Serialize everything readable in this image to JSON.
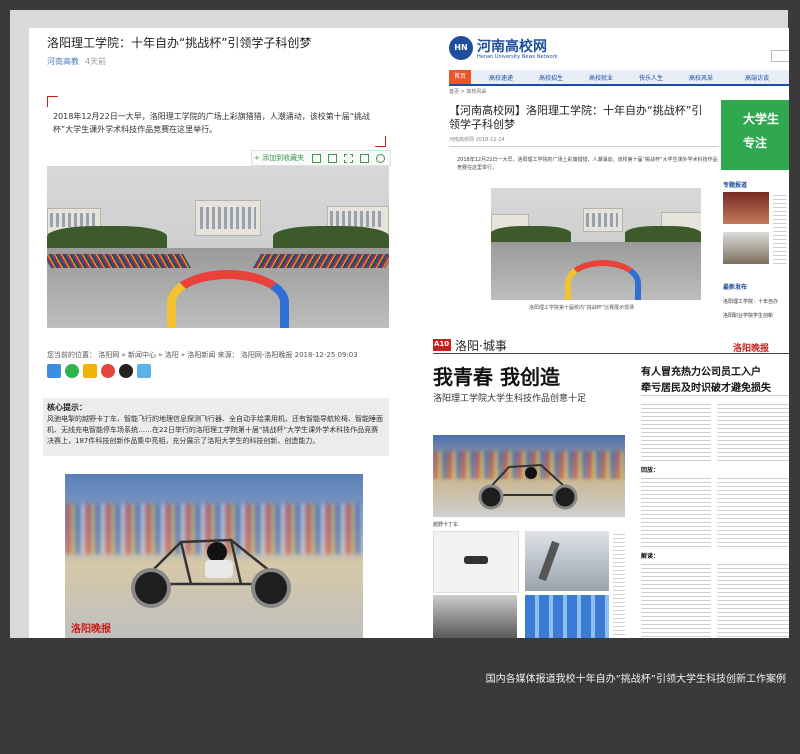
{
  "caption": "国内各媒体报道我校十年自办“挑战杯”引领大学生科技创新工作案例",
  "left_article": {
    "title": "洛阳理工学院：十年自办“挑战杯”引领学子科创梦",
    "source": "河南高教",
    "time_ago": "4天前",
    "lead": "2018年12月22日一大早，洛阳理工学院的广场上彩旗猎猎，人潮涌动，该校第十届“挑战杯”大学生课外学术科技作品竞赛在这里举行。",
    "toolbar_add": "+ 添加到收藏夹",
    "breadcrumb": "您当前的位置：  洛阳网 » 新闻中心 » 洛阳 » 洛阳新闻  来源：  洛阳网-洛阳晚报  2018-12-25 09:03",
    "summary_label": "核心提示：",
    "summary_text": "风驰电掣的越野卡丁车、智能飞行的地理信息探测飞行器、全自动手绘乘用机、还有智能导航轮椅、智能睡面机、无线充电智能停车场系统……在22日举行的洛阳理工学院第十届“挑战杯”大学生课外学术科技作品竞赛决赛上，187件科技创新作品集中亮相，充分展示了洛阳大学生的科技创新、创造能力。",
    "watermark": "洛阳晚报"
  },
  "right_top": {
    "site_name": "河南高校网",
    "site_en": "Henan University News Network",
    "nav": [
      "首页",
      "高校速递",
      "高校招生",
      "高校就业",
      "快乐人生",
      "高校风采",
      "高端访谈"
    ],
    "breadcrumb": "首页 > 高校风采",
    "title": "【河南高校网】洛阳理工学院：十年自办“挑战杯”引领学子科创梦",
    "meta": "河南高校网   2018-12-24",
    "lead": "2018年12月22日一大早，洛阳理工学院的广场上彩旗猎猎，人潮涌动，该校第十届“挑战杯”大学生课外学术科技作品竞赛在这里举行。",
    "photo_caption": "洛阳理工学院第十届校内“挑战杯”比赛展示现场",
    "ad_text1": "大学生",
    "ad_text2": "专注",
    "side_title1": "专题报道",
    "side_title2": "最新发布",
    "side_link1": "洛阳理工学院：十年自办",
    "side_link2": "洛阳职业学院学生创新"
  },
  "right_bottom": {
    "page_no": "A10",
    "section": "洛阳·城事",
    "headline": "我青春  我创造",
    "subhead": "洛阳理工学院大学生科技作品创意十足",
    "side_headline1": "有人冒充热力公司员工入户",
    "side_headline2": "牵亏居民及时识破才避免损失",
    "paper_logo": "洛阳晚报",
    "kart_caption": "越野卡丁车",
    "dept_label1": "回放：",
    "dept_label2": "解读："
  }
}
